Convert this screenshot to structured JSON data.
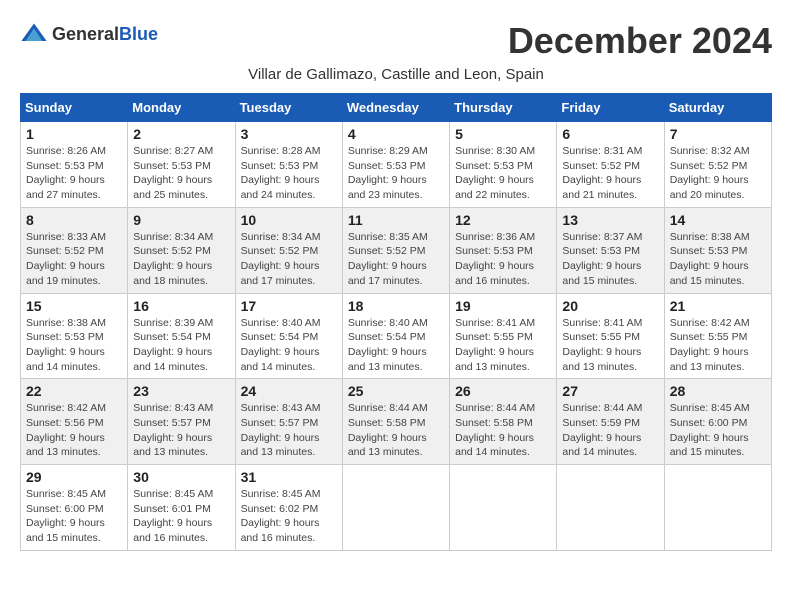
{
  "header": {
    "logo_general": "General",
    "logo_blue": "Blue",
    "month_title": "December 2024",
    "subtitle": "Villar de Gallimazo, Castille and Leon, Spain"
  },
  "weekdays": [
    "Sunday",
    "Monday",
    "Tuesday",
    "Wednesday",
    "Thursday",
    "Friday",
    "Saturday"
  ],
  "weeks": [
    [
      {
        "day": "1",
        "sunrise": "8:26 AM",
        "sunset": "5:53 PM",
        "daylight": "9 hours and 27 minutes."
      },
      {
        "day": "2",
        "sunrise": "8:27 AM",
        "sunset": "5:53 PM",
        "daylight": "9 hours and 25 minutes."
      },
      {
        "day": "3",
        "sunrise": "8:28 AM",
        "sunset": "5:53 PM",
        "daylight": "9 hours and 24 minutes."
      },
      {
        "day": "4",
        "sunrise": "8:29 AM",
        "sunset": "5:53 PM",
        "daylight": "9 hours and 23 minutes."
      },
      {
        "day": "5",
        "sunrise": "8:30 AM",
        "sunset": "5:53 PM",
        "daylight": "9 hours and 22 minutes."
      },
      {
        "day": "6",
        "sunrise": "8:31 AM",
        "sunset": "5:52 PM",
        "daylight": "9 hours and 21 minutes."
      },
      {
        "day": "7",
        "sunrise": "8:32 AM",
        "sunset": "5:52 PM",
        "daylight": "9 hours and 20 minutes."
      }
    ],
    [
      {
        "day": "8",
        "sunrise": "8:33 AM",
        "sunset": "5:52 PM",
        "daylight": "9 hours and 19 minutes."
      },
      {
        "day": "9",
        "sunrise": "8:34 AM",
        "sunset": "5:52 PM",
        "daylight": "9 hours and 18 minutes."
      },
      {
        "day": "10",
        "sunrise": "8:34 AM",
        "sunset": "5:52 PM",
        "daylight": "9 hours and 17 minutes."
      },
      {
        "day": "11",
        "sunrise": "8:35 AM",
        "sunset": "5:52 PM",
        "daylight": "9 hours and 17 minutes."
      },
      {
        "day": "12",
        "sunrise": "8:36 AM",
        "sunset": "5:53 PM",
        "daylight": "9 hours and 16 minutes."
      },
      {
        "day": "13",
        "sunrise": "8:37 AM",
        "sunset": "5:53 PM",
        "daylight": "9 hours and 15 minutes."
      },
      {
        "day": "14",
        "sunrise": "8:38 AM",
        "sunset": "5:53 PM",
        "daylight": "9 hours and 15 minutes."
      }
    ],
    [
      {
        "day": "15",
        "sunrise": "8:38 AM",
        "sunset": "5:53 PM",
        "daylight": "9 hours and 14 minutes."
      },
      {
        "day": "16",
        "sunrise": "8:39 AM",
        "sunset": "5:54 PM",
        "daylight": "9 hours and 14 minutes."
      },
      {
        "day": "17",
        "sunrise": "8:40 AM",
        "sunset": "5:54 PM",
        "daylight": "9 hours and 14 minutes."
      },
      {
        "day": "18",
        "sunrise": "8:40 AM",
        "sunset": "5:54 PM",
        "daylight": "9 hours and 13 minutes."
      },
      {
        "day": "19",
        "sunrise": "8:41 AM",
        "sunset": "5:55 PM",
        "daylight": "9 hours and 13 minutes."
      },
      {
        "day": "20",
        "sunrise": "8:41 AM",
        "sunset": "5:55 PM",
        "daylight": "9 hours and 13 minutes."
      },
      {
        "day": "21",
        "sunrise": "8:42 AM",
        "sunset": "5:55 PM",
        "daylight": "9 hours and 13 minutes."
      }
    ],
    [
      {
        "day": "22",
        "sunrise": "8:42 AM",
        "sunset": "5:56 PM",
        "daylight": "9 hours and 13 minutes."
      },
      {
        "day": "23",
        "sunrise": "8:43 AM",
        "sunset": "5:57 PM",
        "daylight": "9 hours and 13 minutes."
      },
      {
        "day": "24",
        "sunrise": "8:43 AM",
        "sunset": "5:57 PM",
        "daylight": "9 hours and 13 minutes."
      },
      {
        "day": "25",
        "sunrise": "8:44 AM",
        "sunset": "5:58 PM",
        "daylight": "9 hours and 13 minutes."
      },
      {
        "day": "26",
        "sunrise": "8:44 AM",
        "sunset": "5:58 PM",
        "daylight": "9 hours and 14 minutes."
      },
      {
        "day": "27",
        "sunrise": "8:44 AM",
        "sunset": "5:59 PM",
        "daylight": "9 hours and 14 minutes."
      },
      {
        "day": "28",
        "sunrise": "8:45 AM",
        "sunset": "6:00 PM",
        "daylight": "9 hours and 15 minutes."
      }
    ],
    [
      {
        "day": "29",
        "sunrise": "8:45 AM",
        "sunset": "6:00 PM",
        "daylight": "9 hours and 15 minutes."
      },
      {
        "day": "30",
        "sunrise": "8:45 AM",
        "sunset": "6:01 PM",
        "daylight": "9 hours and 16 minutes."
      },
      {
        "day": "31",
        "sunrise": "8:45 AM",
        "sunset": "6:02 PM",
        "daylight": "9 hours and 16 minutes."
      },
      null,
      null,
      null,
      null
    ]
  ]
}
